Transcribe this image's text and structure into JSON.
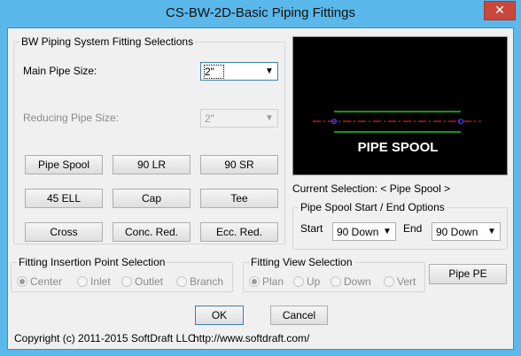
{
  "window": {
    "title": "CS-BW-2D-Basic Piping Fittings",
    "close_glyph": "✕"
  },
  "selections": {
    "group_title": "BW Piping System Fitting Selections",
    "main_pipe_label": "Main Pipe Size:",
    "main_pipe_value": "2\"",
    "reducing_pipe_label": "Reducing Pipe Size:",
    "reducing_pipe_value": "2\"",
    "buttons": [
      "Pipe Spool",
      "90 LR",
      "90 SR",
      "45 ELL",
      "Cap",
      "Tee",
      "Cross",
      "Conc. Red.",
      "Ecc. Red."
    ]
  },
  "preview": {
    "label": "PIPE SPOOL"
  },
  "current_selection": "Current Selection: < Pipe Spool >",
  "spool_options": {
    "group_title": "Pipe Spool Start / End Options",
    "start_label": "Start",
    "start_value": "90 Down",
    "end_label": "End",
    "end_value": "90 Down"
  },
  "insertion_point": {
    "group_title": "Fitting Insertion Point Selection",
    "options": [
      "Center",
      "Inlet",
      "Outlet",
      "Branch"
    ],
    "selected": "Center"
  },
  "view_selection": {
    "group_title": "Fitting View Selection",
    "options": [
      "Plan",
      "Up",
      "Down",
      "Vert"
    ],
    "selected": "Plan"
  },
  "pipe_pe_button": "Pipe PE",
  "ok_button": "OK",
  "cancel_button": "Cancel",
  "footer": {
    "copyright": "Copyright (c) 2011-2015 SoftDraft LLC",
    "url": "http://www.softdraft.com/"
  },
  "colors": {
    "titlebar": "#5ab8ea",
    "preview_bg": "#000000",
    "pipe_green": "#22c422",
    "centerline_red": "#e01e1e",
    "node_blue": "#2a3cff"
  }
}
